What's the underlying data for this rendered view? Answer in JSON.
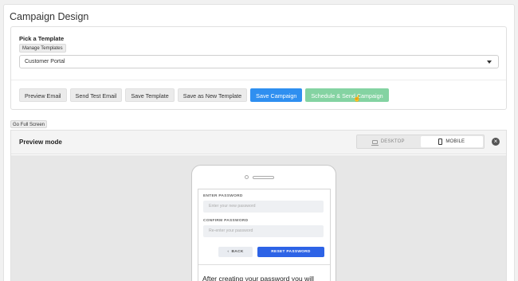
{
  "page": {
    "title": "Campaign Design"
  },
  "template": {
    "label": "Pick a Template",
    "manage_label": "Manage Templates",
    "selected": "Customer Portal"
  },
  "actions": {
    "preview_email": "Preview Email",
    "send_test_email": "Send Test Email",
    "save_template": "Save Template",
    "save_as_new_template": "Save as New Template",
    "save_campaign": "Save Campaign",
    "schedule_send": "Schedule & Send Campaign"
  },
  "fullscreen_label": "Go Full Screen",
  "preview": {
    "title": "Preview mode",
    "desktop_label": "DESKTOP",
    "mobile_label": "MOBILE",
    "active_mode": "MOBILE",
    "close_icon": "close-icon"
  },
  "email": {
    "enter_password_label": "ENTER PASSWORD",
    "enter_password_placeholder": "Enter your new password",
    "confirm_password_label": "CONFIRM PASSWORD",
    "confirm_password_placeholder": "Re-enter your password",
    "back_label": "BACK",
    "reset_label": "RESET PASSWORD",
    "body_text": "After creating your password you will"
  },
  "colors": {
    "primary": "#2f8ff0",
    "success": "#84d3a2",
    "email_button": "#2d63e6"
  }
}
